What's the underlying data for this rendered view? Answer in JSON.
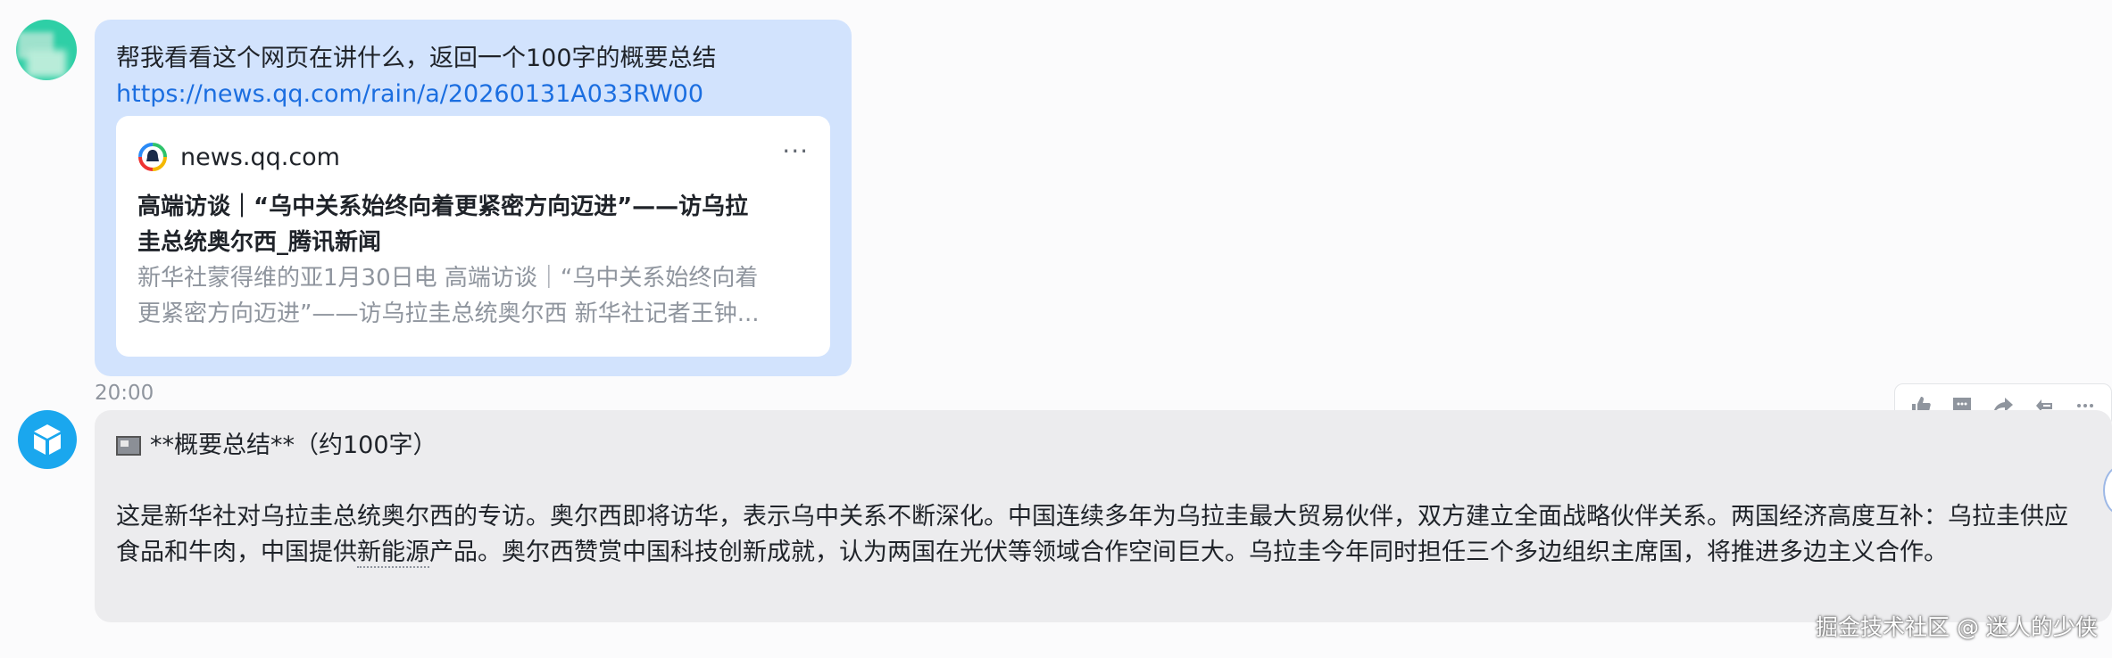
{
  "user_message": {
    "text": "帮我看看这个网页在讲什么，返回一个100字的概要总结",
    "link": "https://news.qq.com/rain/a/20260131A033RW00",
    "card": {
      "domain": "news.qq.com",
      "more": "···",
      "title_line1": "高端访谈｜“乌中关系始终向着更紧密方向迈进”——访乌拉",
      "title_line2": "圭总统奥尔西_腾讯新闻",
      "desc_line1": "新华社蒙得维的亚1月30日电 高端访谈｜“乌中关系始终向着",
      "desc_line2": "更紧密方向迈进”——访乌拉圭总统奥尔西 新华社记者王钟..."
    }
  },
  "timestamp": "20:00",
  "bot_message": {
    "heading": "**概要总结**（约100字）",
    "body_before": "这是新华社对乌拉圭总统奥尔西的专访。奥尔西即将访华，表示乌中关系不断深化。中国连续多年为乌拉圭最大贸易伙伴，双方建立全面战略伙伴关系。两国经济高度互补：乌拉圭供应食品和牛肉，中国提供",
    "body_highlight": "新能源",
    "body_after": "产品。奥尔西赞赏中国科技创新成就，认为两国在光伏等领域合作空间巨大。乌拉圭今年同时担任三个多边组织主席国，将推进多边主义合作。"
  },
  "toolbar": {
    "icons": [
      "thumbs-up-icon",
      "comment-icon",
      "forward-icon",
      "quote-icon",
      "more-icon"
    ]
  },
  "watermark": "掘金技术社区 @ 迷人的少侠",
  "colors": {
    "user_bubble": "#d2e3fd",
    "bot_bubble": "#ececee",
    "link": "#1b6ee0",
    "bot_avatar": "#1aa7ee",
    "user_avatar": "#2ecfa6"
  }
}
